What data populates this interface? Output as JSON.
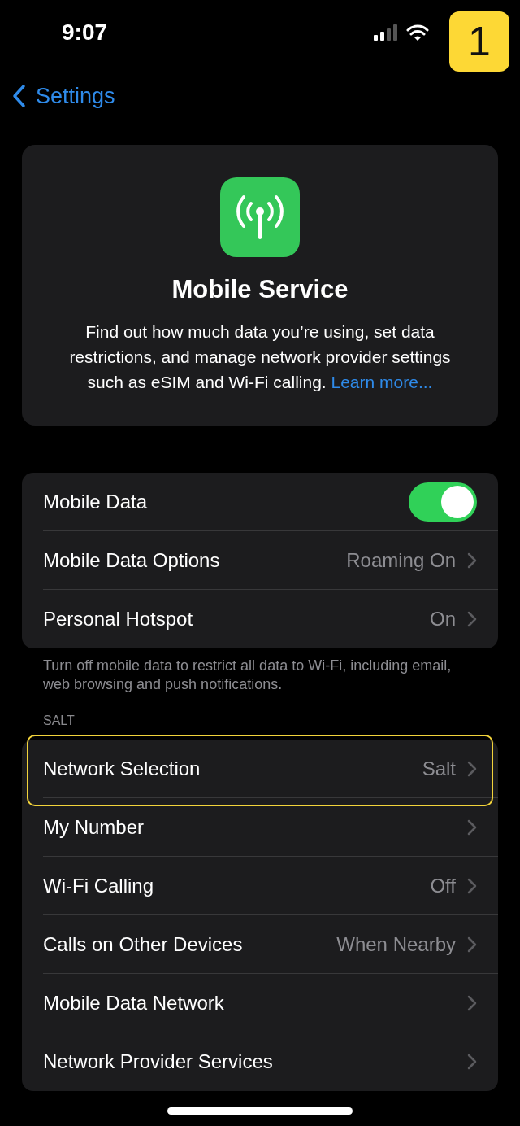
{
  "status_bar": {
    "time": "9:07",
    "step_badge": "1"
  },
  "nav": {
    "back_label": "Settings"
  },
  "header": {
    "title": "Mobile Service",
    "description": "Find out how much data you’re using, set data restrictions, and manage network provider settings such as eSIM and Wi-Fi calling.",
    "link": "Learn more..."
  },
  "groups": [
    {
      "items": [
        {
          "kind": "toggle",
          "label": "Mobile Data",
          "on": true
        },
        {
          "kind": "link",
          "label": "Mobile Data Options",
          "value": "Roaming On"
        },
        {
          "kind": "link",
          "label": "Personal Hotspot",
          "value": "On"
        }
      ],
      "footer": "Turn off mobile data to restrict all data to Wi-Fi, including email, web browsing and push notifications."
    },
    {
      "header": "SALT",
      "items": [
        {
          "kind": "link",
          "label": "Network Selection",
          "value": "Salt",
          "highlighted": true
        },
        {
          "kind": "link",
          "label": "My Number"
        },
        {
          "kind": "link",
          "label": "Wi-Fi Calling",
          "value": "Off"
        },
        {
          "kind": "link",
          "label": "Calls on Other Devices",
          "value": "When Nearby"
        },
        {
          "kind": "link",
          "label": "Mobile Data Network"
        },
        {
          "kind": "link",
          "label": "Network Provider Services"
        }
      ]
    }
  ]
}
